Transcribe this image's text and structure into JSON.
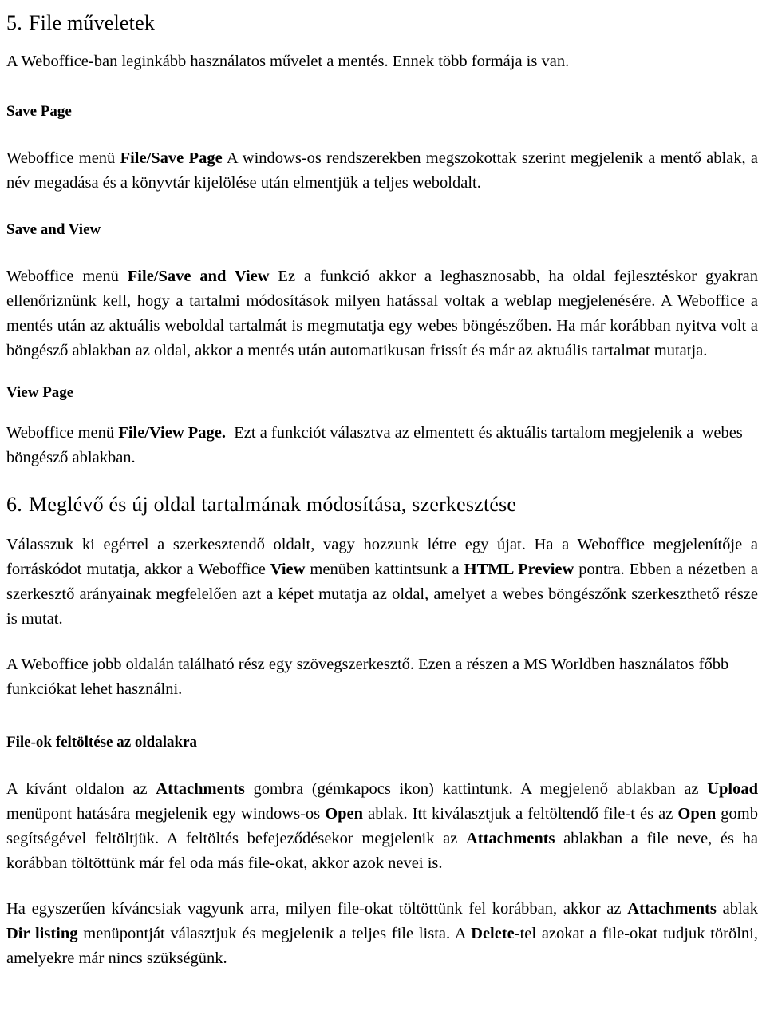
{
  "document": {
    "language": "hu",
    "text_color": "#000000",
    "background_color": "#ffffff"
  },
  "blocks": [
    {
      "type": "chapter-heading",
      "name": "heading-file-muveletek",
      "number": "5.",
      "text": "File műveletek"
    },
    {
      "type": "paragraph",
      "name": "paragraph-intro",
      "runs": [
        {
          "text": "A Weboffice-ban leginkább használatos művelet a mentés. Ennek több formája is van.",
          "bold": false
        }
      ]
    },
    {
      "type": "sub-heading",
      "name": "subheading-save-page",
      "text": "Save Page"
    },
    {
      "type": "paragraph",
      "name": "paragraph-save-page",
      "runs": [
        {
          "text": "Weboffice menü ",
          "bold": false
        },
        {
          "text": "File/Save Page",
          "bold": true
        },
        {
          "text": " A windows-os rendszerekben megszokottak szerint megjelenik a mentő ablak, a név megadása és a könyvtár kijelölése után elmentjük a teljes weboldalt.",
          "bold": false
        }
      ]
    },
    {
      "type": "sub-heading",
      "name": "subheading-save-and-view",
      "text": "Save and View"
    },
    {
      "type": "paragraph",
      "name": "paragraph-save-and-view",
      "runs": [
        {
          "text": "Weboffice menü ",
          "bold": false
        },
        {
          "text": "File/Save and View",
          "bold": true
        },
        {
          "text": " Ez a funkció akkor a leghasznosabb, ha oldal fejlesztéskor gyakran ellenőriznünk kell, hogy a tartalmi módosítások milyen hatással voltak a weblap megjelenésére. A Weboffice a mentés után az aktuális weboldal tartalmát is megmutatja egy webes böngészőben. Ha már korábban nyitva volt a böngésző ablakban az oldal, akkor a mentés után automatikusan frissít és már az aktuális tartalmat mutatja.",
          "bold": false
        }
      ]
    },
    {
      "type": "sub-heading",
      "name": "subheading-view-page",
      "text": "View Page"
    },
    {
      "type": "paragraph",
      "name": "paragraph-view-page",
      "runs": [
        {
          "text": "Weboffice menü ",
          "bold": false
        },
        {
          "text": "File/View Page.",
          "bold": true
        },
        {
          "text": "  Ezt a funkciót választva az elmentett és aktuális tartalom megjelenik a  webes böngésző ablakban.",
          "bold": false
        }
      ]
    },
    {
      "type": "chapter-heading",
      "name": "heading-meglevo-es-uj-oldal",
      "number": "6.",
      "text": "Meglévő és új oldal tartalmának módosítása, szerkesztése"
    },
    {
      "type": "paragraph",
      "name": "paragraph-szerkesztes",
      "runs": [
        {
          "text": "Válasszuk ki egérrel a szerkesztendő oldalt, vagy hozzunk létre egy újat. Ha a Weboffice megjelenítője a forráskódot mutatja, akkor a Weboffice ",
          "bold": false
        },
        {
          "text": "View",
          "bold": true
        },
        {
          "text": " menüben kattintsunk a ",
          "bold": false
        },
        {
          "text": "HTML Preview",
          "bold": true
        },
        {
          "text": " pontra. Ebben a nézetben a szerkesztő arányainak megfelelően azt a képet mutatja az oldal, amelyet a webes böngészőnk szerkeszthető része is mutat.",
          "bold": false
        }
      ]
    },
    {
      "type": "paragraph",
      "name": "paragraph-szovegszerkeszto",
      "runs": [
        {
          "text": "A Weboffice jobb oldalán található rész egy szövegszerkesztő. Ezen a részen a MS Worldben használatos főbb funkciókat lehet használni.",
          "bold": false
        }
      ]
    },
    {
      "type": "sub-heading",
      "name": "subheading-file-ok-feltoltese",
      "text": "File-ok feltöltése az oldalakra"
    },
    {
      "type": "paragraph",
      "name": "paragraph-attachments-upload",
      "runs": [
        {
          "text": "A kívánt oldalon az ",
          "bold": false
        },
        {
          "text": "Attachments",
          "bold": true
        },
        {
          "text": " gombra (gémkapocs ikon) kattintunk. A megjelenő ablakban az ",
          "bold": false
        },
        {
          "text": "Upload",
          "bold": true
        },
        {
          "text": " menüpont hatására megjelenik egy windows-os ",
          "bold": false
        },
        {
          "text": "Open",
          "bold": true
        },
        {
          "text": " ablak. Itt kiválasztjuk a feltöltendő file-t és az ",
          "bold": false
        },
        {
          "text": "Open",
          "bold": true
        },
        {
          "text": " gomb segítségével feltöltjük. A feltöltés befejeződésekor megjelenik az ",
          "bold": false
        },
        {
          "text": "Attachments",
          "bold": true
        },
        {
          "text": " ablakban a file neve, és ha korábban töltöttünk már fel oda más file-okat, akkor azok nevei is.",
          "bold": false
        }
      ]
    },
    {
      "type": "paragraph",
      "name": "paragraph-dir-listing",
      "runs": [
        {
          "text": "Ha egyszerűen kíváncsiak vagyunk arra, milyen file-okat töltöttünk fel korábban, akkor az ",
          "bold": false
        },
        {
          "text": "Attachments",
          "bold": true
        },
        {
          "text": " ablak ",
          "bold": false
        },
        {
          "text": "Dir listing",
          "bold": true
        },
        {
          "text": " menüpontját választjuk és megjelenik a teljes file lista. A ",
          "bold": false
        },
        {
          "text": "Delete",
          "bold": true
        },
        {
          "text": "-tel azokat a file-okat tudjuk törölni, amelyekre már nincs szükségünk.",
          "bold": false
        }
      ]
    }
  ]
}
